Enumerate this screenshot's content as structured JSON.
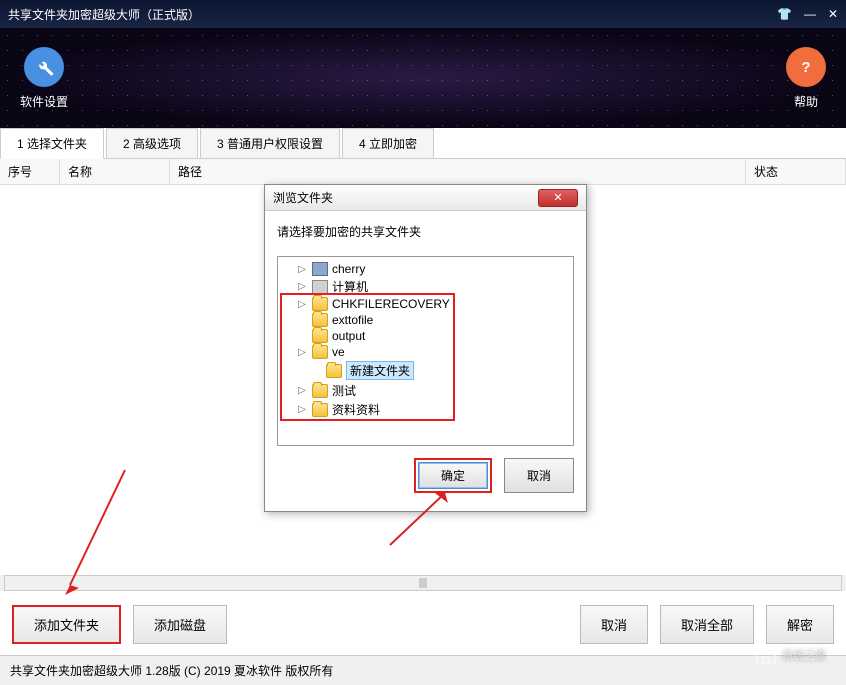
{
  "window": {
    "title": "共享文件夹加密超级大师（正式版）"
  },
  "header": {
    "settings_label": "软件设置",
    "help_label": "帮助"
  },
  "tabs": [
    {
      "label": "1 选择文件夹",
      "active": true
    },
    {
      "label": "2 高级选项",
      "active": false
    },
    {
      "label": "3 普通用户权限设置",
      "active": false
    },
    {
      "label": "4 立即加密",
      "active": false
    }
  ],
  "table": {
    "columns": {
      "seq": "序号",
      "name": "名称",
      "path": "路径",
      "status": "状态"
    }
  },
  "buttons": {
    "add_folder": "添加文件夹",
    "add_disk": "添加磁盘",
    "cancel": "取消",
    "cancel_all": "取消全部",
    "decrypt": "解密"
  },
  "status_bar": "共享文件夹加密超级大师  1.28版  (C) 2019 夏冰软件  版权所有",
  "dialog": {
    "title": "浏览文件夹",
    "prompt": "请选择要加密的共享文件夹",
    "tree": [
      {
        "label": "cherry",
        "indent": 1,
        "expandable": true,
        "icon": "user"
      },
      {
        "label": "计算机",
        "indent": 1,
        "expandable": true,
        "icon": "computer"
      },
      {
        "label": "CHKFILERECOVERY",
        "indent": 1,
        "expandable": true,
        "icon": "folder"
      },
      {
        "label": "exttofile",
        "indent": 1,
        "expandable": false,
        "icon": "folder"
      },
      {
        "label": "output",
        "indent": 1,
        "expandable": false,
        "icon": "folder"
      },
      {
        "label": "ve",
        "indent": 1,
        "expandable": true,
        "icon": "folder"
      },
      {
        "label": "新建文件夹",
        "indent": 2,
        "expandable": false,
        "icon": "folder",
        "selected": true
      },
      {
        "label": "测试",
        "indent": 1,
        "expandable": true,
        "icon": "folder"
      },
      {
        "label": "资料资料",
        "indent": 1,
        "expandable": true,
        "icon": "folder"
      }
    ],
    "ok": "确定",
    "cancel": "取消"
  },
  "watermark": "系统之家"
}
